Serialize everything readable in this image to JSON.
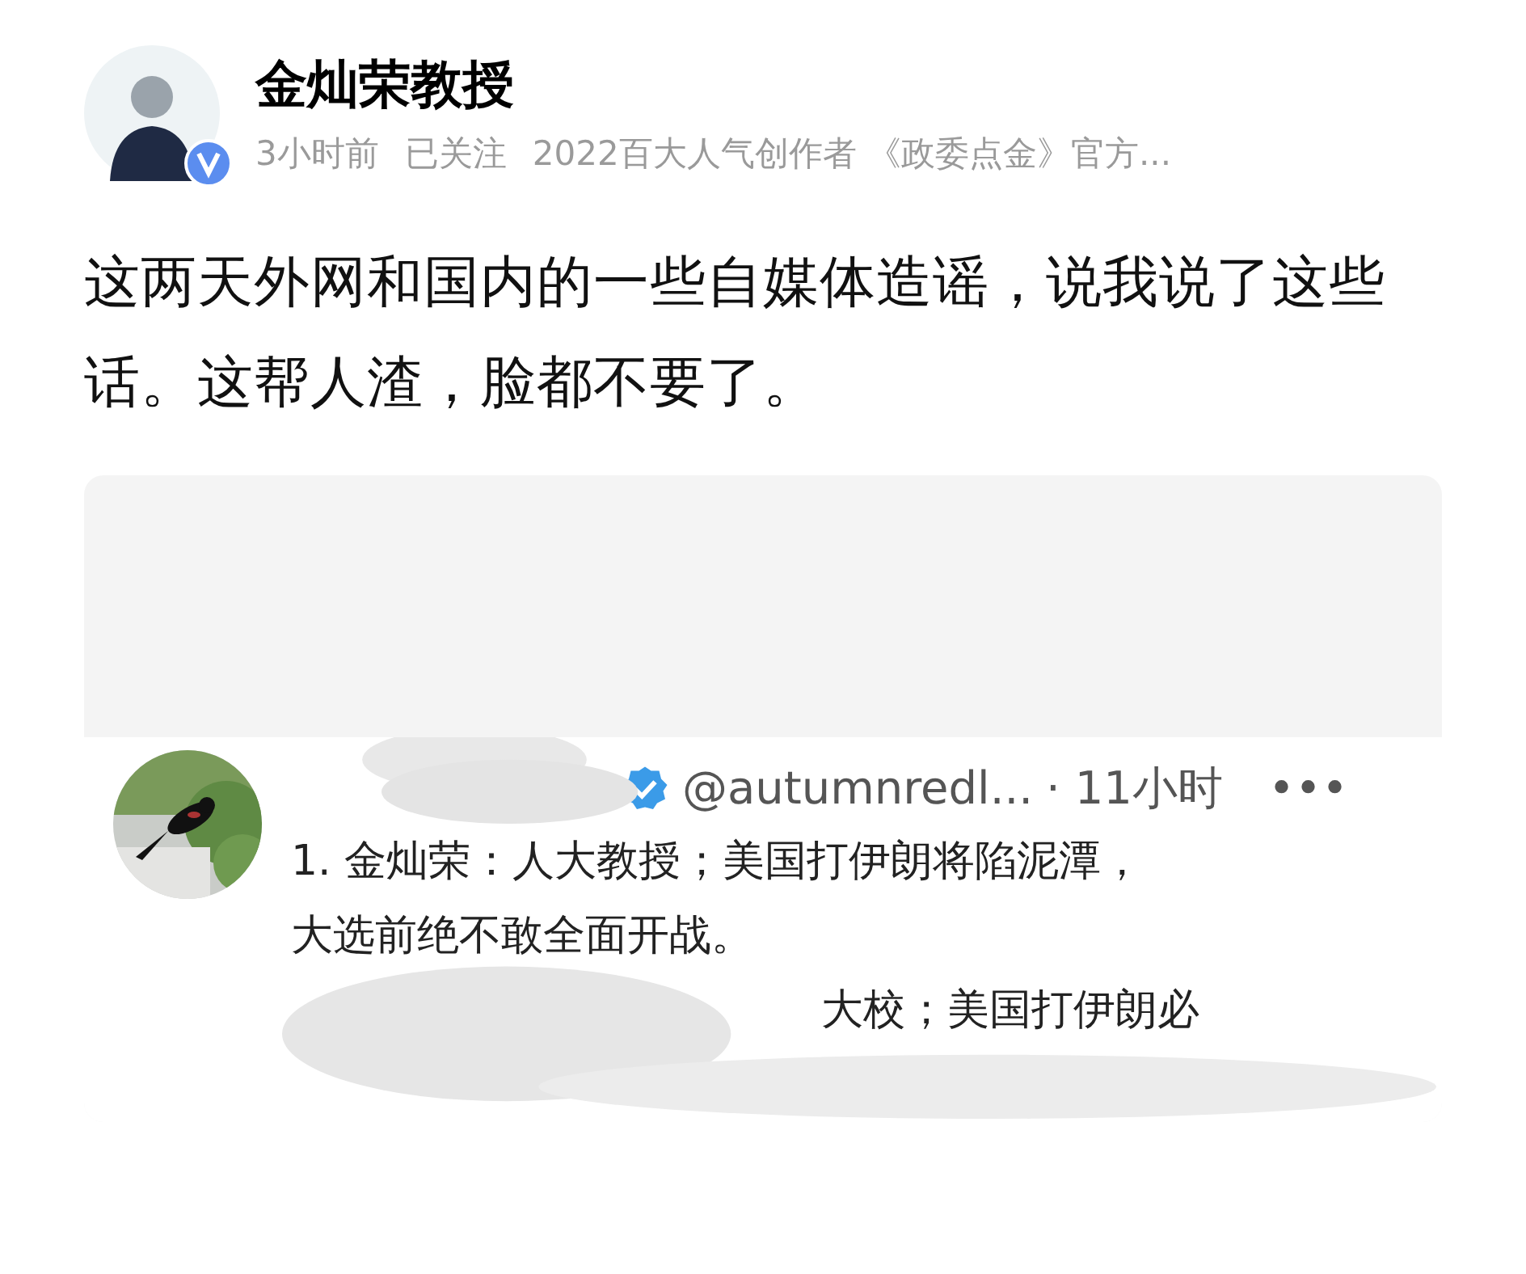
{
  "post": {
    "author": "金灿荣教授",
    "verified": true,
    "time": "3小时前",
    "follow_status": "已关注",
    "tagline": "2022百大人气创作者 《政委点金》官方...",
    "body": "这两天外网和国内的一些自媒体造谣，说我说了这些话。这帮人渣，脸都不要了。"
  },
  "embedded_screenshot": {
    "verified": true,
    "handle": "@autumnredl...",
    "time": "· 11小时",
    "more": "•••",
    "lines": [
      "1. 金灿荣：人大教授；美国打伊朗将陷泥潭，",
      "大选前绝不敢全面开战。",
      "大校；美国打伊朗必"
    ]
  }
}
